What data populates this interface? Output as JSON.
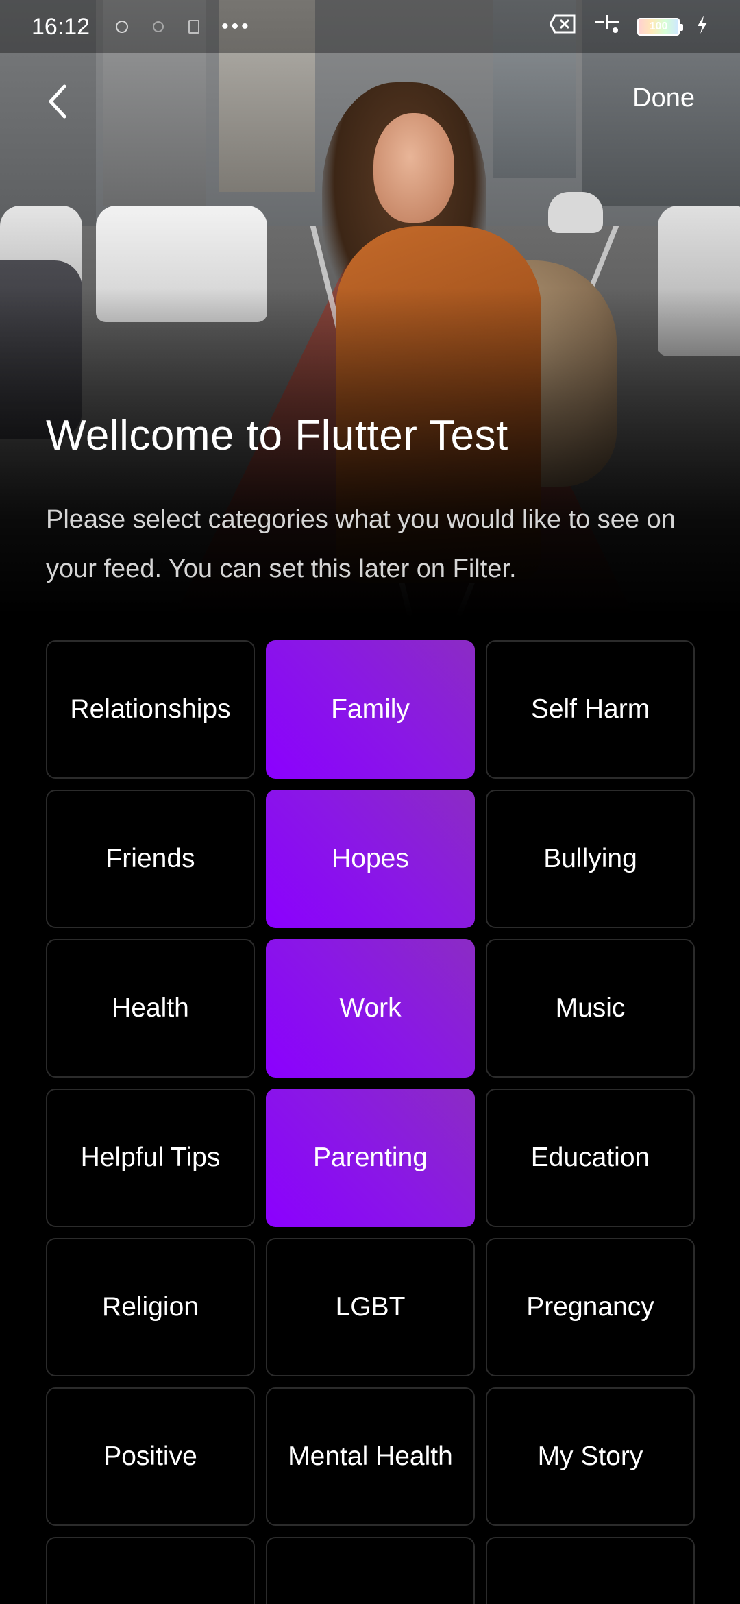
{
  "status_bar": {
    "time": "16:12",
    "battery_level": "100"
  },
  "nav": {
    "back_icon": "chevron-left-icon",
    "done_label": "Done"
  },
  "header": {
    "title": "Wellcome to Flutter Test",
    "subtitle": "Please select categories what you would like to see on your feed. You can set this later on Filter."
  },
  "colors": {
    "selected_gradient_start": "#8b00ff",
    "selected_gradient_end": "#8b2cc4",
    "tile_border": "#2b2b2b",
    "background": "#000000"
  },
  "categories": [
    {
      "label": "Relationships",
      "selected": false
    },
    {
      "label": "Family",
      "selected": true
    },
    {
      "label": "Self Harm",
      "selected": false
    },
    {
      "label": "Friends",
      "selected": false
    },
    {
      "label": "Hopes",
      "selected": true
    },
    {
      "label": "Bullying",
      "selected": false
    },
    {
      "label": "Health",
      "selected": false
    },
    {
      "label": "Work",
      "selected": true
    },
    {
      "label": "Music",
      "selected": false
    },
    {
      "label": "Helpful Tips",
      "selected": false
    },
    {
      "label": "Parenting",
      "selected": true
    },
    {
      "label": "Education",
      "selected": false
    },
    {
      "label": "Religion",
      "selected": false
    },
    {
      "label": "LGBT",
      "selected": false
    },
    {
      "label": "Pregnancy",
      "selected": false
    },
    {
      "label": "Positive",
      "selected": false
    },
    {
      "label": "Mental Health",
      "selected": false
    },
    {
      "label": "My Story",
      "selected": false
    },
    {
      "label": "",
      "selected": false
    },
    {
      "label": "",
      "selected": false
    },
    {
      "label": "",
      "selected": false
    }
  ]
}
